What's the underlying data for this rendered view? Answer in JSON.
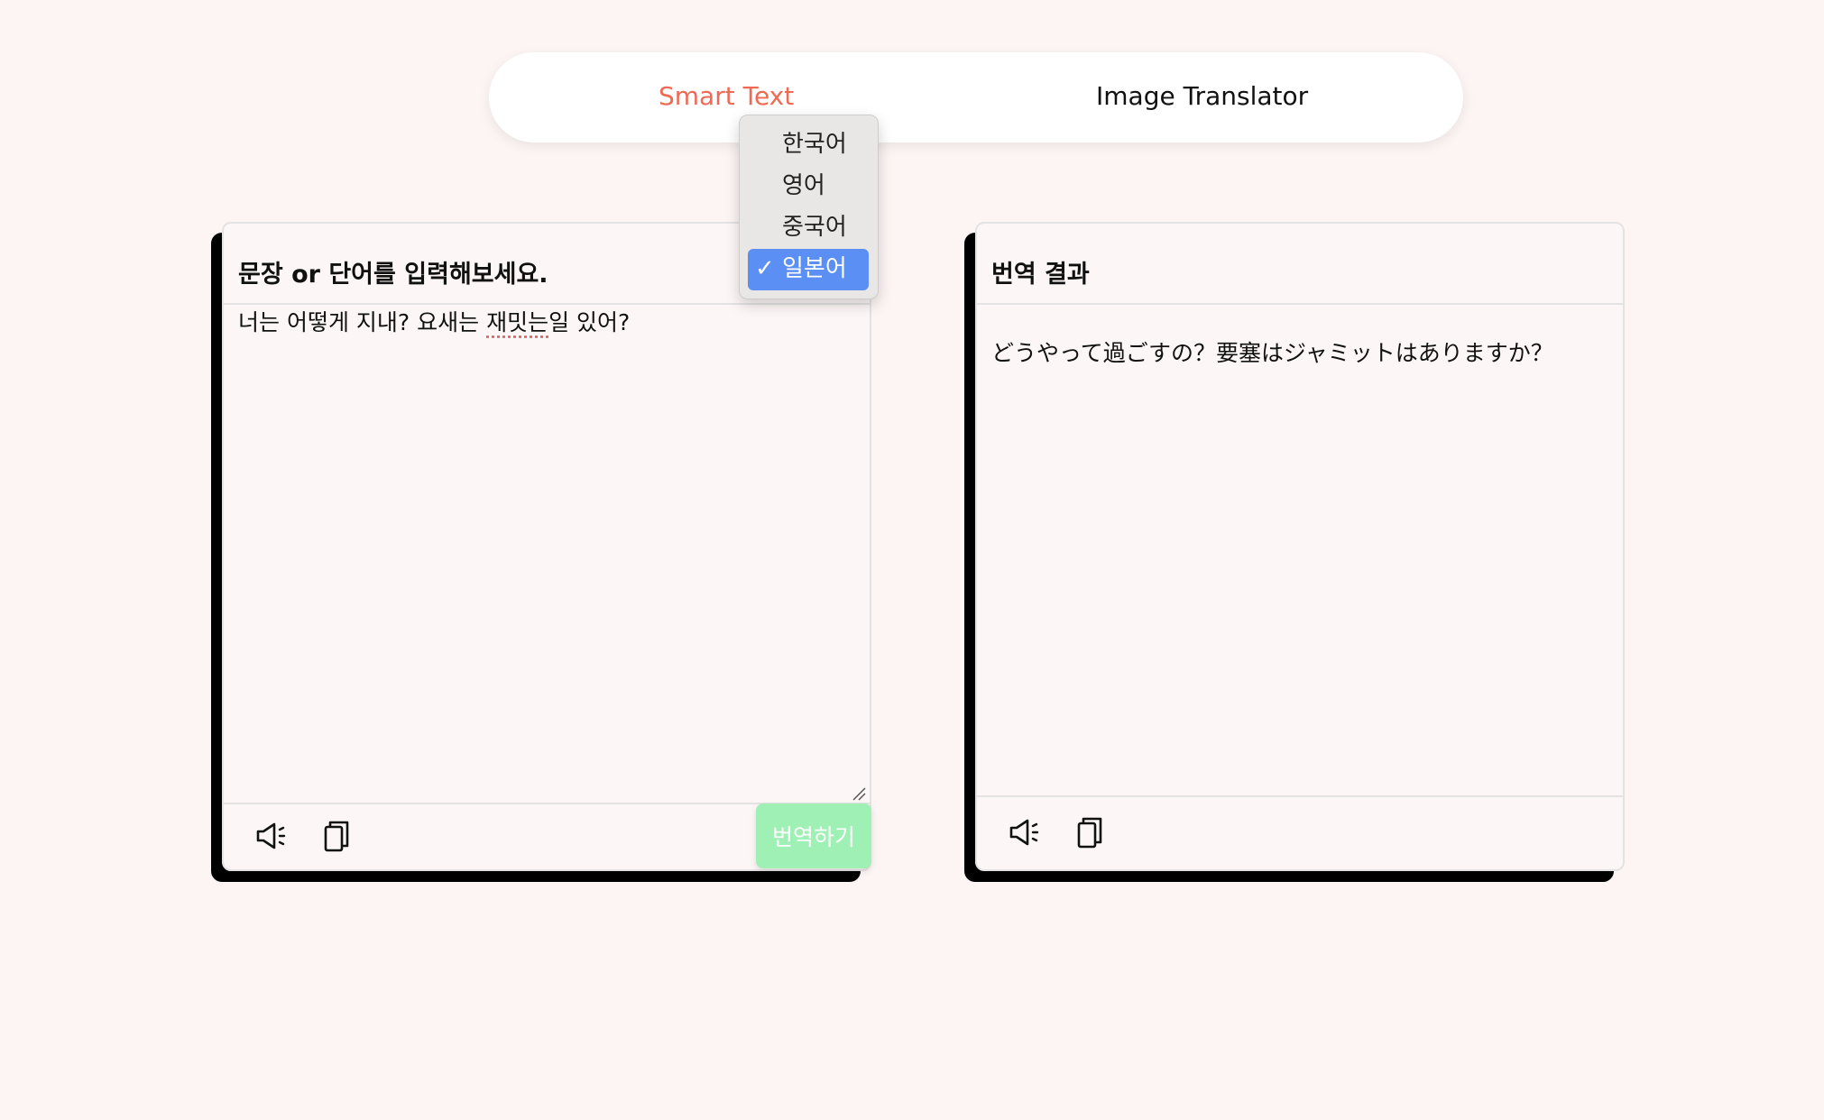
{
  "nav": {
    "tabs": [
      {
        "label": "Smart Text",
        "active": true
      },
      {
        "label": "Image Translator",
        "active": false
      }
    ]
  },
  "source_panel": {
    "title": "문장 or 단어를 입력해보세요.",
    "input_text_before": "너는 어떻게 지내? 요새는 ",
    "input_text_misspelled": "재밋는",
    "input_text_after": "일 있어?",
    "translate_button": "번역하기",
    "speaker_icon": "speaker-icon",
    "copy_icon": "copy-icon"
  },
  "result_panel": {
    "title": "번역 결과",
    "result_text": "どうやって過ごすの？要塞はジャミットはありますか？",
    "speaker_icon": "speaker-icon",
    "copy_icon": "copy-icon"
  },
  "language_dropdown": {
    "options": [
      "한국어",
      "영어",
      "중국어",
      "일본어"
    ],
    "selected": "일본어",
    "check_mark": "✓"
  },
  "colors": {
    "background": "#fcf5f4",
    "active_tab": "#ee6a55",
    "translate_button": "#9ff0b4",
    "selected_option": "#5b8ff4"
  }
}
